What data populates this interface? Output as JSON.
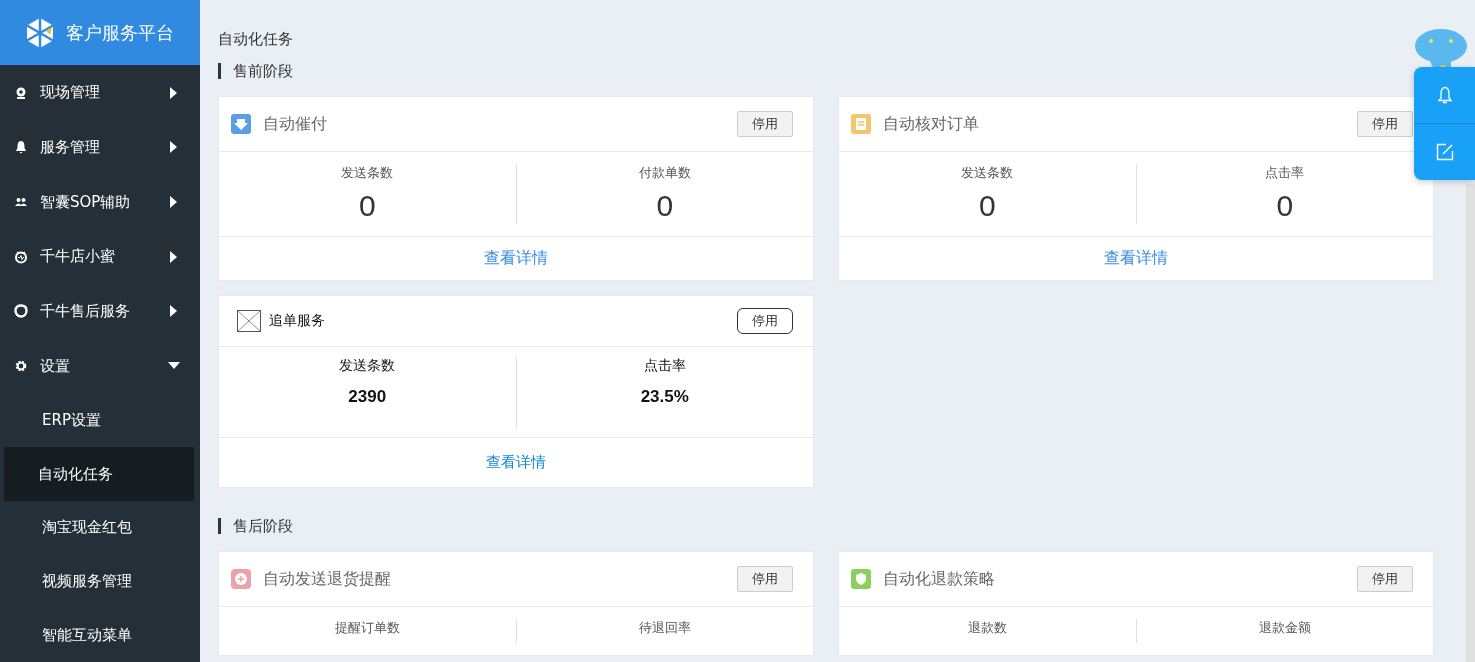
{
  "brand": {
    "title": "客户服务平台"
  },
  "sidebar": {
    "items": [
      {
        "label": "现场管理",
        "expanded": false
      },
      {
        "label": "服务管理",
        "expanded": false
      },
      {
        "label": "智囊SOP辅助",
        "expanded": false
      },
      {
        "label": "千牛店小蜜",
        "expanded": false
      },
      {
        "label": "千牛售后服务",
        "expanded": false
      },
      {
        "label": "设置",
        "expanded": true,
        "children": [
          {
            "label": "ERP设置",
            "selected": false
          },
          {
            "label": "自动化任务",
            "selected": true
          },
          {
            "label": "淘宝现金红包",
            "selected": false
          },
          {
            "label": "视频服务管理",
            "selected": false
          },
          {
            "label": "智能互动菜单",
            "selected": false
          }
        ]
      }
    ]
  },
  "page_title": "自动化任务",
  "sections": [
    {
      "title": "售前阶段",
      "cards": [
        {
          "kind": "standard",
          "title": "自动催付",
          "color": "#5b9ee6",
          "button": "停用",
          "stats": [
            {
              "label": "发送条数",
              "value": "0"
            },
            {
              "label": "付款单数",
              "value": "0"
            }
          ],
          "link": "查看详情"
        },
        {
          "kind": "standard",
          "title": "自动核对订单",
          "color": "#f5c46b",
          "button": "停用",
          "stats": [
            {
              "label": "发送条数",
              "value": "0"
            },
            {
              "label": "点击率",
              "value": "0"
            }
          ],
          "link": "查看详情"
        },
        {
          "kind": "plain",
          "title": "追单服务",
          "button": "停用",
          "stats": [
            {
              "label": "发送条数",
              "value": "2390"
            },
            {
              "label": "点击率",
              "value": "23.5%"
            }
          ],
          "link": "查看详情"
        }
      ]
    },
    {
      "title": "售后阶段",
      "cards": [
        {
          "kind": "standard",
          "title": "自动发送退货提醒",
          "color": "#f0a0a8",
          "button": "停用",
          "stats": [
            {
              "label": "提醒订单数"
            },
            {
              "label": "待退回率"
            }
          ]
        },
        {
          "kind": "standard",
          "title": "自动化退款策略",
          "color": "#8ccf5a",
          "button": "停用",
          "stats": [
            {
              "label": "退款数"
            },
            {
              "label": "退款金额"
            }
          ]
        }
      ]
    }
  ]
}
